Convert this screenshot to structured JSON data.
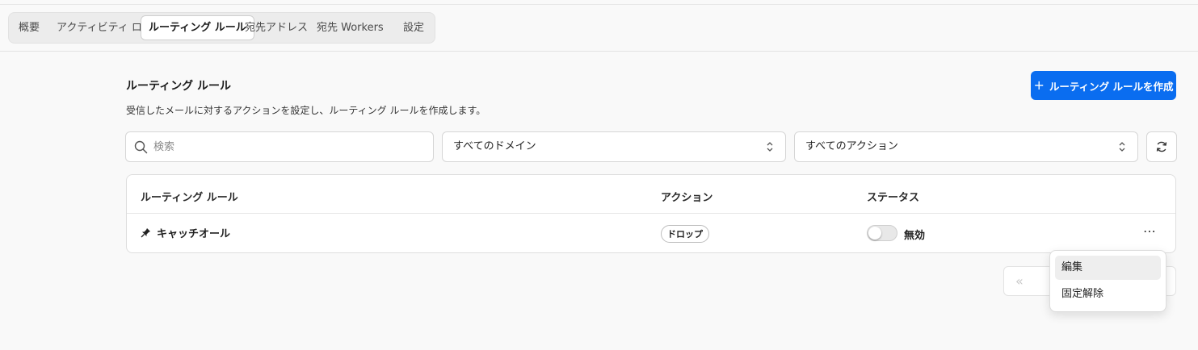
{
  "tabs": [
    {
      "label": "概要"
    },
    {
      "label": "アクティビティ ログ"
    },
    {
      "label": "ルーティング ルール",
      "active": true
    },
    {
      "label": "宛先アドレス"
    },
    {
      "label": "宛先 Workers"
    },
    {
      "label": "設定"
    }
  ],
  "section": {
    "title": "ルーティング ルール",
    "description": "受信したメールに対するアクションを設定し、ルーティング ルールを作成します。",
    "create_button": "ルーティング ルールを作成"
  },
  "filters": {
    "search_placeholder": "検索",
    "domain_select": "すべてのドメイン",
    "action_select": "すべてのアクション"
  },
  "table": {
    "headers": {
      "rule": "ルーティング ルール",
      "action": "アクション",
      "status": "ステータス"
    },
    "rows": [
      {
        "name": "キャッチオール",
        "action": "ドロップ",
        "status": "無効",
        "enabled": false,
        "pinned": true
      }
    ]
  },
  "pagination": {
    "first_icon": "«"
  },
  "context_menu": {
    "items": [
      {
        "label": "編集"
      },
      {
        "label": "固定解除"
      }
    ]
  },
  "colors": {
    "accent": "#0a6df0"
  },
  "icons": [
    "search-icon",
    "chevron-updown-icon",
    "refresh-icon",
    "pin-icon",
    "more-icon",
    "plus-icon"
  ]
}
